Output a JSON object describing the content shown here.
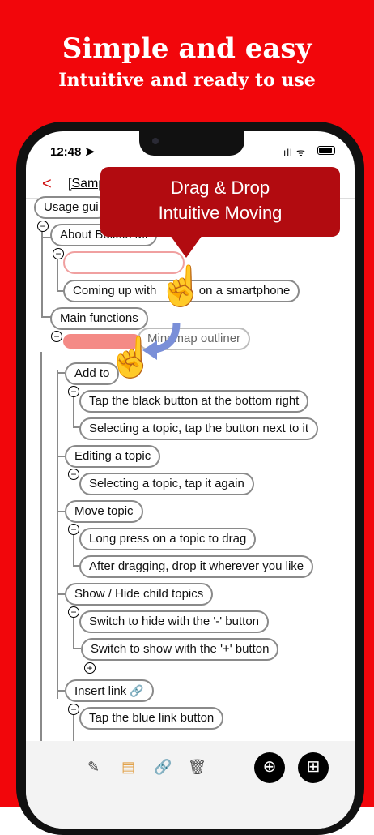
{
  "promo": {
    "title": "Simple and easy",
    "subtitle": "Intuitive and ready to use"
  },
  "status": {
    "time": "12:48 ➤",
    "icons": "ıll ᯤ"
  },
  "nav": {
    "back": "<",
    "title": "[Samp"
  },
  "callout": {
    "line1": "Drag & Drop",
    "line2": "Intuitive Moving"
  },
  "tree": {
    "usage": "Usage gui",
    "about": "About Bullets Mi",
    "coming_up": "Coming up with",
    "coming_up_tail": "on a smartphone",
    "main_functions": "Main functions",
    "mindmap": "Mindmap outliner",
    "add_topic": "Add to",
    "tap_black": "Tap the black button at the bottom right",
    "select_next": "Selecting a topic, tap the button next to it",
    "editing": "Editing a topic",
    "select_again": "Selecting a topic, tap it again",
    "move_topic": "Move topic",
    "long_press": "Long press on a topic to drag",
    "after_drag": "After dragging, drop it wherever you like",
    "show_hide": "Show / Hide child topics",
    "switch_hide": "Switch to hide with the '-' button",
    "switch_show": "Switch to show with the '+' button",
    "insert_link": "Insert link",
    "tap_blue": "Tap the blue link button"
  },
  "toggles": {
    "minus": "−",
    "plus": "+"
  },
  "icons": {
    "edit": "✎",
    "document": "▤",
    "link": "🔗",
    "trash": "🗑",
    "add_child": "⊕",
    "add_sibling": "⊞",
    "hand_gray": "☝",
    "hand_dark": "☝"
  },
  "colors": {
    "background": "#f2060b",
    "callout": "#b20b10",
    "drag_bar": "#f48a86",
    "arrow": "#7a8fd8"
  }
}
